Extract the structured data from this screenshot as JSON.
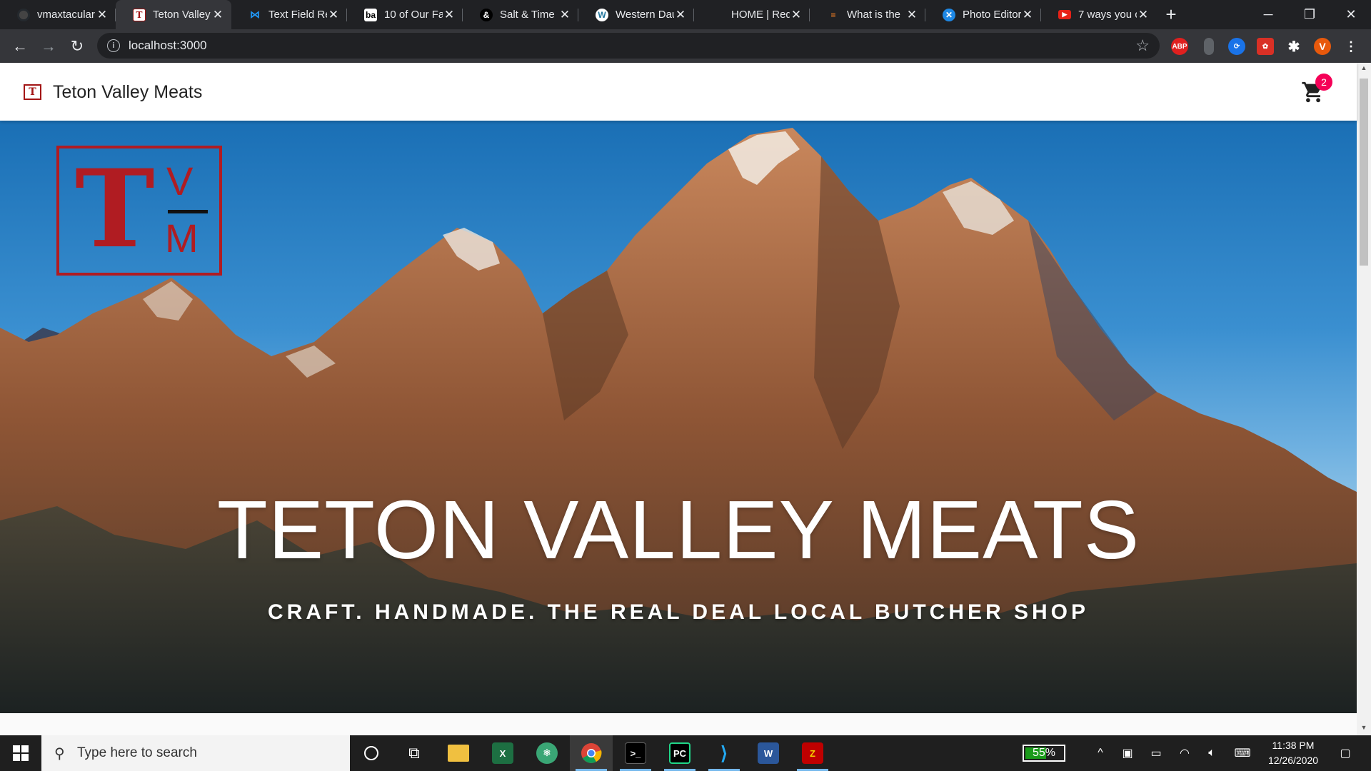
{
  "browser": {
    "tabs": [
      {
        "title": "vmaxtacular",
        "favicon": "github-icon",
        "active": false
      },
      {
        "title": "Teton Valley",
        "favicon": "tvm-icon",
        "active": true
      },
      {
        "title": "Text Field Re",
        "favicon": "material-ui-icon",
        "active": false
      },
      {
        "title": "10 of Our Fa",
        "favicon": "ba-icon",
        "active": false
      },
      {
        "title": "Salt & Time",
        "favicon": "ampersand-icon",
        "active": false
      },
      {
        "title": "Western Dau",
        "favicon": "wordpress-icon",
        "active": false
      },
      {
        "title": "HOME | Red",
        "favicon": "blank-icon",
        "active": false
      },
      {
        "title": "What is the",
        "favicon": "stackoverflow-icon",
        "active": false
      },
      {
        "title": "Photo Editor",
        "favicon": "photo-editor-icon",
        "active": false
      },
      {
        "title": "7 ways you c",
        "favicon": "youtube-icon",
        "active": false
      }
    ],
    "address": "localhost:3000",
    "profile_initial": "V",
    "extensions": [
      "ABP",
      "extension-1",
      "extension-2",
      "extension-3",
      "puzzle-icon"
    ]
  },
  "app": {
    "brand_name": "Teton Valley Meats",
    "logo_small": "T",
    "cart_count": "2",
    "hero_logo": {
      "big": "T",
      "top": "V",
      "bottom": "M"
    },
    "hero_title": "TETON VALLEY MEATS",
    "hero_subtitle": "CRAFT. HANDMADE. THE REAL DEAL LOCAL BUTCHER SHOP"
  },
  "taskbar": {
    "search_placeholder": "Type here to search",
    "apps": [
      "cortana-icon",
      "task-view-icon",
      "file-explorer-icon",
      "excel-icon",
      "atom-icon",
      "chrome-icon",
      "terminal-icon",
      "pycharm-icon",
      "vscode-icon",
      "word-icon",
      "filezilla-icon"
    ],
    "battery_percent": "55%",
    "battery_level": 0.55,
    "time": "11:38 PM",
    "date": "12/26/2020"
  },
  "colors": {
    "brand_red": "#b01c22",
    "badge": "#f50057",
    "chrome_dark": "#202124",
    "chrome_toolbar": "#35363a"
  }
}
